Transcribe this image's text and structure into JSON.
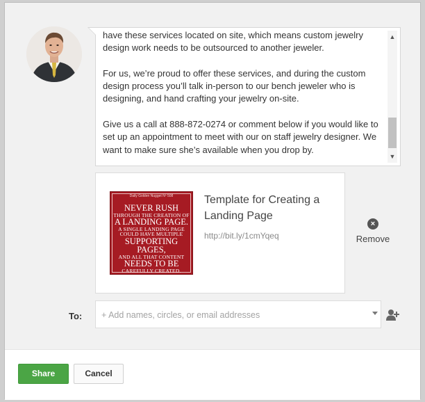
{
  "post": {
    "paragraphs": [
      "have these services located on site, which means custom jewelry design work needs to be outsourced to another jeweler.",
      "For us, we’re proud to offer these services, and during the custom design process you’ll talk in-person to our bench jeweler who is designing, and hand crafting your jewelry on-site.",
      "Give us a call at 888-872-0274 or comment below if you would like to set up an appointment to meet with our on staff jewelry designer. We want to make sure she’s available when you drop by."
    ]
  },
  "link_preview": {
    "title": "Template for Creating a Landing Page",
    "url": "http://bit.ly/1cmYqeq",
    "thumbnail": {
      "header": "Daily Golden Nugget Nº 508",
      "lines": [
        {
          "text": "Never Rush",
          "size": "big"
        },
        {
          "text": "through the creation of",
          "size": "small"
        },
        {
          "text": "a landing page.",
          "size": "big"
        },
        {
          "text": "A single landing page",
          "size": "small"
        },
        {
          "text": "could have multiple",
          "size": "small"
        },
        {
          "text": "supporting pages,",
          "size": "big"
        },
        {
          "text": "and all that content",
          "size": "small"
        },
        {
          "text": "needs to be",
          "size": "big"
        },
        {
          "text": "carefully created.",
          "size": "small"
        }
      ]
    },
    "remove_label": "Remove"
  },
  "recipients": {
    "label": "To:",
    "placeholder": "+ Add names, circles, or email addresses"
  },
  "actions": {
    "share_label": "Share",
    "cancel_label": "Cancel"
  },
  "colors": {
    "share_button": "#4ba545",
    "thumbnail_background": "#a61b23"
  }
}
